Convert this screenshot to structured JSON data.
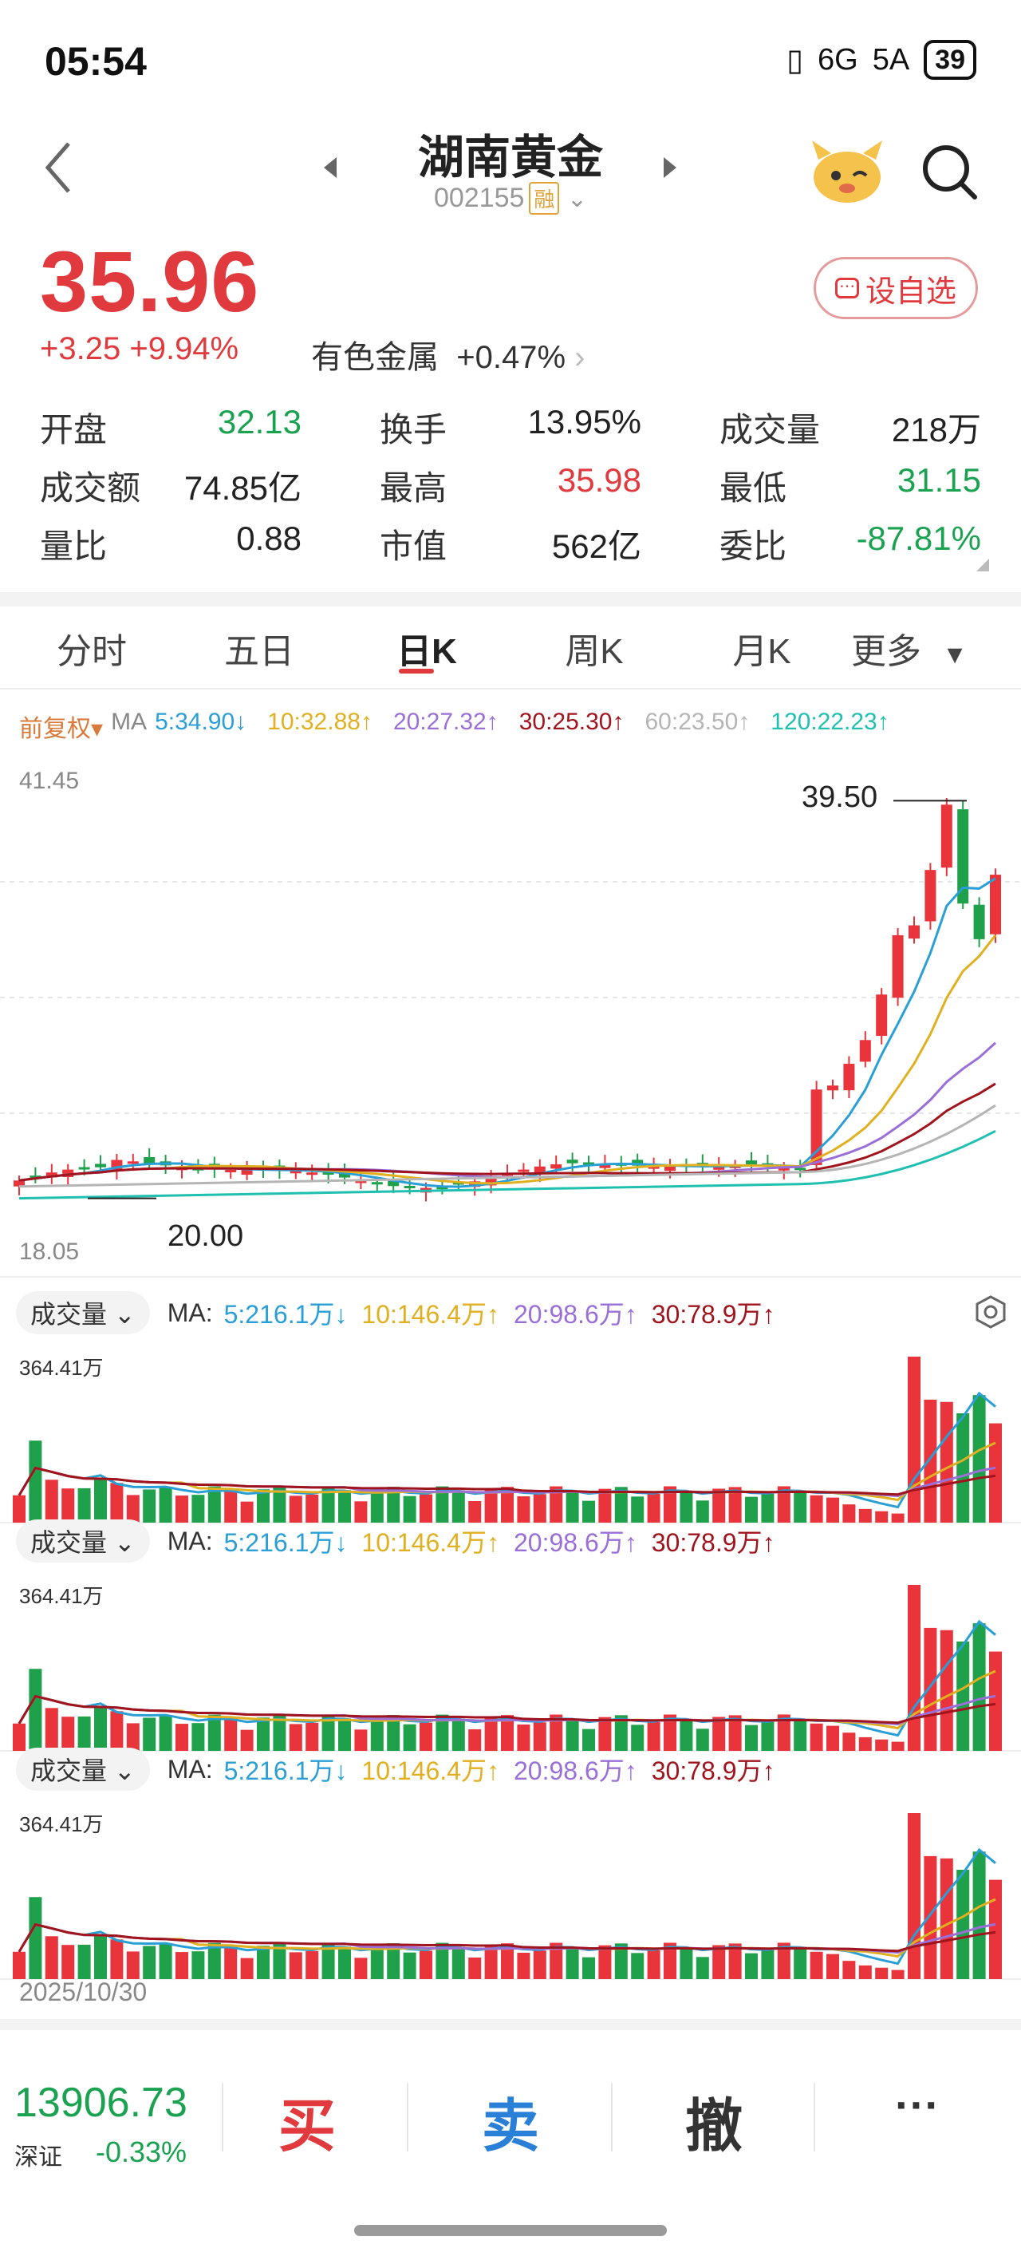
{
  "status_bar": {
    "time": "05:54",
    "network": "6G",
    "signal": "5A",
    "battery": "39"
  },
  "header": {
    "stock_name": "湖南黄金",
    "stock_code": "002155",
    "badge": "融"
  },
  "quote": {
    "price": "35.96",
    "change": "+3.25",
    "change_pct": "+9.94%",
    "sector": "有色金属",
    "sector_change": "+0.47%",
    "watch_label": "设自选"
  },
  "stats": [
    {
      "label": "开盘",
      "value": "32.13",
      "color": "green"
    },
    {
      "label": "换手",
      "value": "13.95%",
      "color": "black"
    },
    {
      "label": "成交量",
      "value": "218万",
      "color": "black"
    },
    {
      "label": "成交额",
      "value": "74.85亿",
      "color": "black"
    },
    {
      "label": "最高",
      "value": "35.98",
      "color": "red"
    },
    {
      "label": "最低",
      "value": "31.15",
      "color": "green"
    },
    {
      "label": "量比",
      "value": "0.88",
      "color": "black"
    },
    {
      "label": "市值",
      "value": "562亿",
      "color": "black"
    },
    {
      "label": "委比",
      "value": "-87.81%",
      "color": "green"
    }
  ],
  "tabs": [
    "分时",
    "五日",
    "日K",
    "周K",
    "月K",
    "更多"
  ],
  "active_tab": "日K",
  "ma_row": {
    "adjust": "前复权",
    "ma_label": "MA",
    "items": [
      {
        "text": "5:34.90",
        "arrow": "↓",
        "color": "#2a9fd6"
      },
      {
        "text": "10:32.88",
        "arrow": "↑",
        "color": "#e0b020"
      },
      {
        "text": "20:27.32",
        "arrow": "↑",
        "color": "#9a6fd8"
      },
      {
        "text": "30:25.30",
        "arrow": "↑",
        "color": "#a0141e"
      },
      {
        "text": "60:23.50",
        "arrow": "↑",
        "color": "#b5b5b5"
      },
      {
        "text": "120:22.23",
        "arrow": "↑",
        "color": "#20c0b0"
      }
    ]
  },
  "kline": {
    "price_max_label": "41.45",
    "price_min_label": "18.05",
    "high_marker": "39.50",
    "low_marker": "20.00"
  },
  "volume_panel": {
    "selector": "成交量",
    "ma_label": "MA:",
    "max_label": "364.41万",
    "items": [
      {
        "text": "5:216.1万",
        "arrow": "↓",
        "color": "#2a9fd6"
      },
      {
        "text": "10:146.4万",
        "arrow": "↑",
        "color": "#e0b020"
      },
      {
        "text": "20:98.6万",
        "arrow": "↑",
        "color": "#9a6fd8"
      },
      {
        "text": "30:78.9万",
        "arrow": "↑",
        "color": "#a0141e"
      }
    ]
  },
  "chart_data": {
    "type": "candlestick",
    "title": "",
    "ylim": [
      18.05,
      41.45
    ],
    "annotations": [
      "39.50",
      "20.00"
    ],
    "recent_closes": [
      25.1,
      25.3,
      26.4,
      27.6,
      29.9,
      32.9,
      33.4,
      36.2,
      39.5,
      34.5,
      32.7,
      35.96
    ],
    "recent_volumes_wan": [
      60,
      55,
      40,
      30,
      25,
      20,
      364.41,
      270,
      265,
      240,
      280,
      218
    ]
  },
  "footer": {
    "date": "2025/10/30",
    "index_value": "13906.73",
    "index_name": "深证",
    "index_change": "-0.33%",
    "buy": "买",
    "sell": "卖",
    "cancel": "撤",
    "more": "···"
  }
}
